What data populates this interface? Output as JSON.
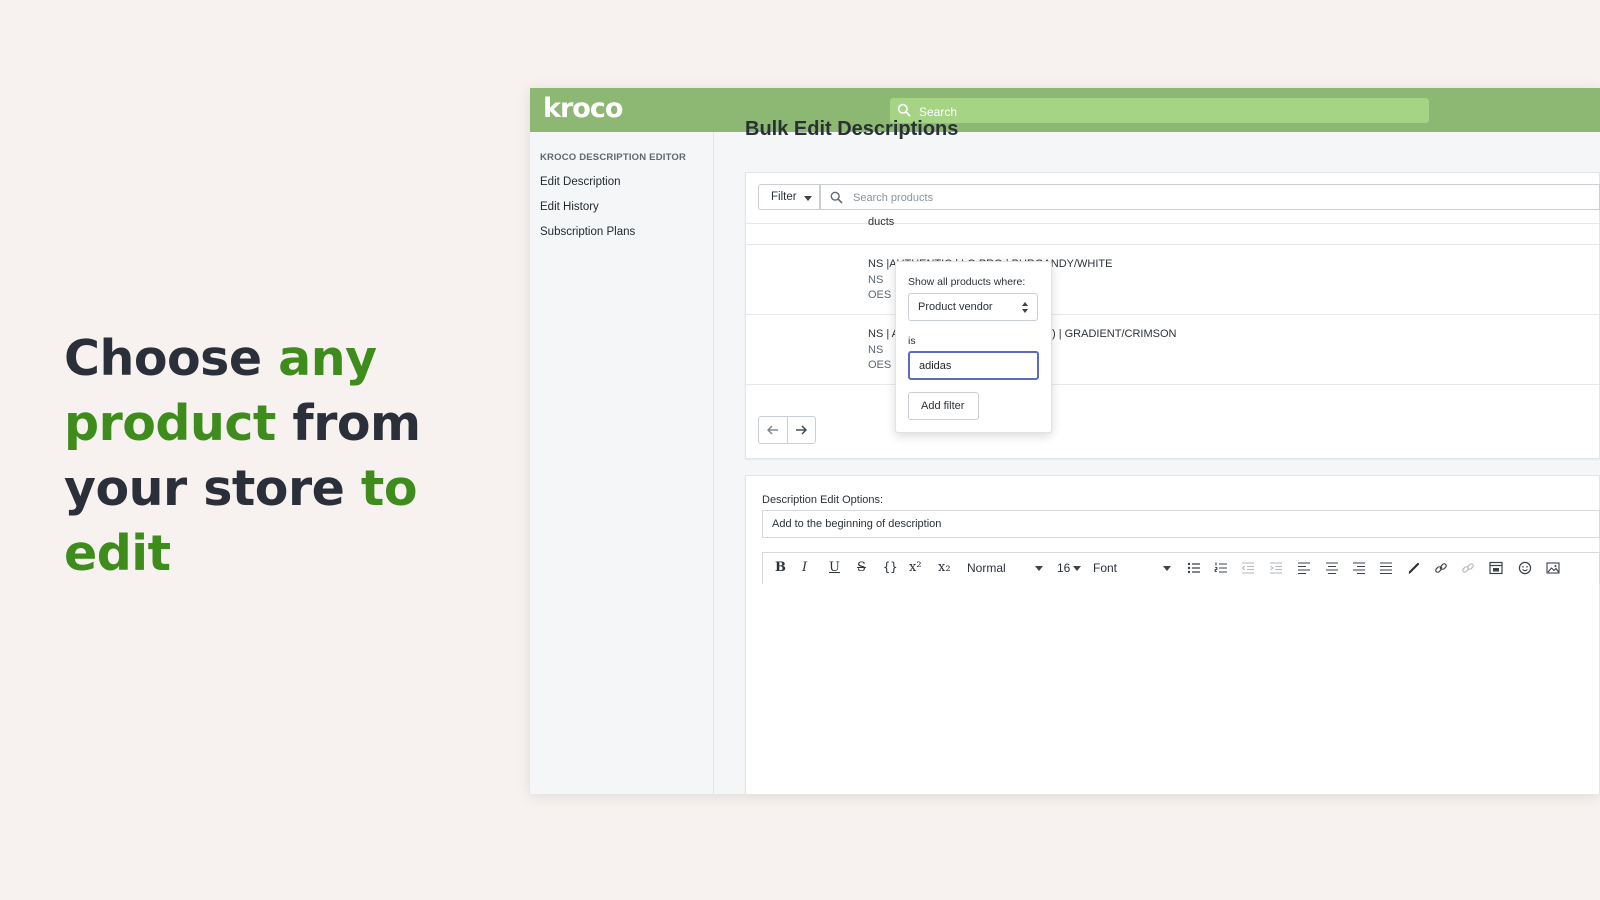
{
  "headline": {
    "line1_a": "Choose ",
    "line1_b": "any",
    "line2_a": "product",
    "line2_b": " from",
    "line3_a": "your store ",
    "line3_b": "to edit"
  },
  "app": {
    "logo": "kroco",
    "search_placeholder": "Search",
    "sidebar": {
      "title": "KROCO DESCRIPTION EDITOR",
      "items": [
        "Edit Description",
        "Edit History",
        "Subscription Plans"
      ]
    },
    "page_title": "Bulk Edit Descriptions",
    "filter": {
      "button_label": "Filter",
      "search_placeholder": "Search products",
      "selected_text": "ducts",
      "popover": {
        "show_label": "Show all products where:",
        "field_selected": "Product vendor",
        "operator_label": "is",
        "value": "adidas",
        "add_button": "Add filter"
      }
    },
    "products": [
      {
        "title": "NS |AUTHENTIC | LO PRO | BURGANDY/WHITE",
        "vendor": "NS",
        "type": "OES"
      },
      {
        "title": "NS | AUTHENTIC | (MULTI EYELETS) | GRADIENT/CRIMSON",
        "vendor": "NS",
        "type": "OES"
      }
    ],
    "editor": {
      "options_label": "Description Edit Options:",
      "option_selected": "Add to the beginning of description",
      "format_selected": "Normal",
      "size_selected": "16",
      "font_selected": "Font"
    },
    "colors": {
      "brand_green": "#8db873",
      "search_green": "#a5d485",
      "headline_green": "#3d8c1c",
      "focus_border": "#5c6ac4"
    }
  }
}
